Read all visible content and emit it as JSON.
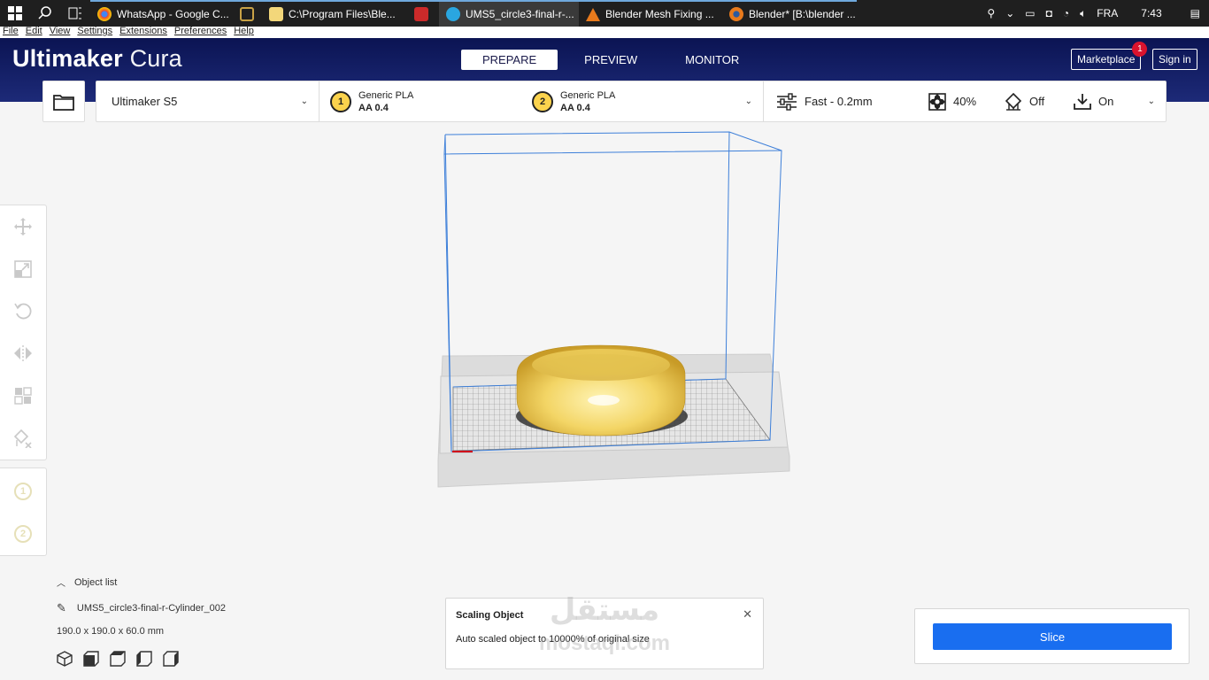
{
  "taskbar": {
    "apps": [
      {
        "label": "WhatsApp - Google C...",
        "color": "#e8b33d"
      },
      {
        "label": "",
        "color": "#c9a246"
      },
      {
        "label": "C:\\Program Files\\Ble...",
        "color": "#f3d77a"
      },
      {
        "label": "",
        "color": "#cc2a2a"
      },
      {
        "label": "UMS5_circle3-final-r-...",
        "color": "#2aa6e0"
      },
      {
        "label": "Blender Mesh Fixing ...",
        "color": "#e87a1c"
      },
      {
        "label": "Blender* [B:\\blender ...",
        "color": "#e87a1c"
      }
    ],
    "tray": {
      "language": "FRA",
      "time": "7:43"
    }
  },
  "menu": [
    "File",
    "Edit",
    "View",
    "Settings",
    "Extensions",
    "Preferences",
    "Help"
  ],
  "header": {
    "logo_brand": "Ultimaker",
    "logo_product": "Cura",
    "tabs": [
      "PREPARE",
      "PREVIEW",
      "MONITOR"
    ],
    "marketplace_label": "Marketplace",
    "marketplace_badge": "1",
    "signin_label": "Sign in"
  },
  "toolbar": {
    "printer": "Ultimaker S5",
    "extruders": [
      {
        "num": "1",
        "material": "Generic PLA",
        "nozzle": "AA 0.4"
      },
      {
        "num": "2",
        "material": "Generic PLA",
        "nozzle": "AA 0.4"
      }
    ],
    "profile": "Fast - 0.2mm",
    "infill": "40%",
    "support": "Off",
    "adhesion": "On"
  },
  "objects": {
    "header": "Object list",
    "name": "UMS5_circle3-final-r-Cylinder_002",
    "dimensions": "190.0 x 190.0 x 60.0 mm"
  },
  "message": {
    "title": "Scaling Object",
    "body": "Auto scaled object to 10000% of original size",
    "close": "✕"
  },
  "watermark": {
    "arabic": "مستقل",
    "latin": "mostaql.com"
  },
  "slice": {
    "label": "Slice"
  },
  "colors": {
    "header": "#0b1453",
    "accent": "#196ef0",
    "extruder": "#fbd34d",
    "badge": "#d9132d"
  }
}
